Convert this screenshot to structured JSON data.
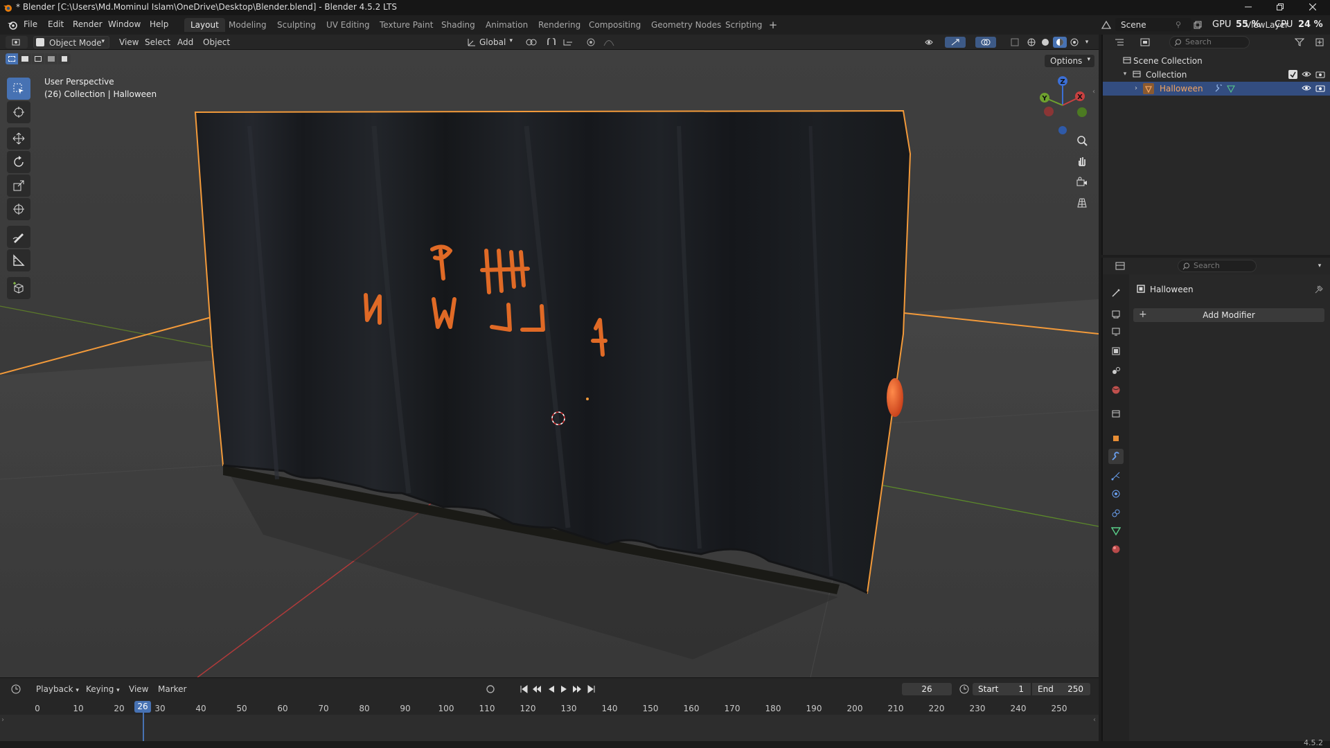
{
  "window": {
    "title": "* Blender [C:\\Users\\Md.Mominul Islam\\OneDrive\\Desktop\\Blender.blend] - Blender 4.5.2 LTS"
  },
  "menubar": {
    "menus": [
      "File",
      "Edit",
      "Render",
      "Window",
      "Help"
    ],
    "workspaces": [
      "Layout",
      "Modeling",
      "Sculpting",
      "UV Editing",
      "Texture Paint",
      "Shading",
      "Animation",
      "Rendering",
      "Compositing",
      "Geometry Nodes",
      "Scripting"
    ],
    "active_workspace": "Layout",
    "scene_label": "Scene",
    "viewlayer_label": "ViewLayer",
    "gpu_label": "GPU",
    "gpu_value": "55 %",
    "cpu_label": "CPU",
    "cpu_value": "24 %"
  },
  "viewport_header": {
    "mode": "Object Mode",
    "menus": [
      "View",
      "Select",
      "Add",
      "Object"
    ],
    "orientation": "Global",
    "options_label": "Options"
  },
  "viewport": {
    "overlay_line1": "User Perspective",
    "overlay_line2": "(26) Collection | Halloween",
    "selected_object": "Halloween",
    "gizmo_axes": [
      "X",
      "Y",
      "Z"
    ]
  },
  "outliner": {
    "search_placeholder": "Search",
    "scene_collection": "Scene Collection",
    "collection": "Collection",
    "object": "Halloween"
  },
  "properties": {
    "search_placeholder": "Search",
    "object_name": "Halloween",
    "add_modifier": "Add Modifier"
  },
  "timeline": {
    "menus": [
      "Playback",
      "Keying",
      "View",
      "Marker"
    ],
    "current_frame": "26",
    "start_label": "Start",
    "start_value": "1",
    "end_label": "End",
    "end_value": "250",
    "ticks": [
      "0",
      "10",
      "20",
      "30",
      "40",
      "50",
      "60",
      "70",
      "80",
      "90",
      "100",
      "110",
      "120",
      "130",
      "140",
      "150",
      "160",
      "170",
      "180",
      "190",
      "200",
      "210",
      "220",
      "230",
      "240",
      "250"
    ]
  },
  "statusbar": {
    "version": "4.5.2"
  },
  "colors": {
    "accent_blue": "#4772b3",
    "selection_orange": "#f39a3a",
    "letter_orange": "#e06a26"
  }
}
